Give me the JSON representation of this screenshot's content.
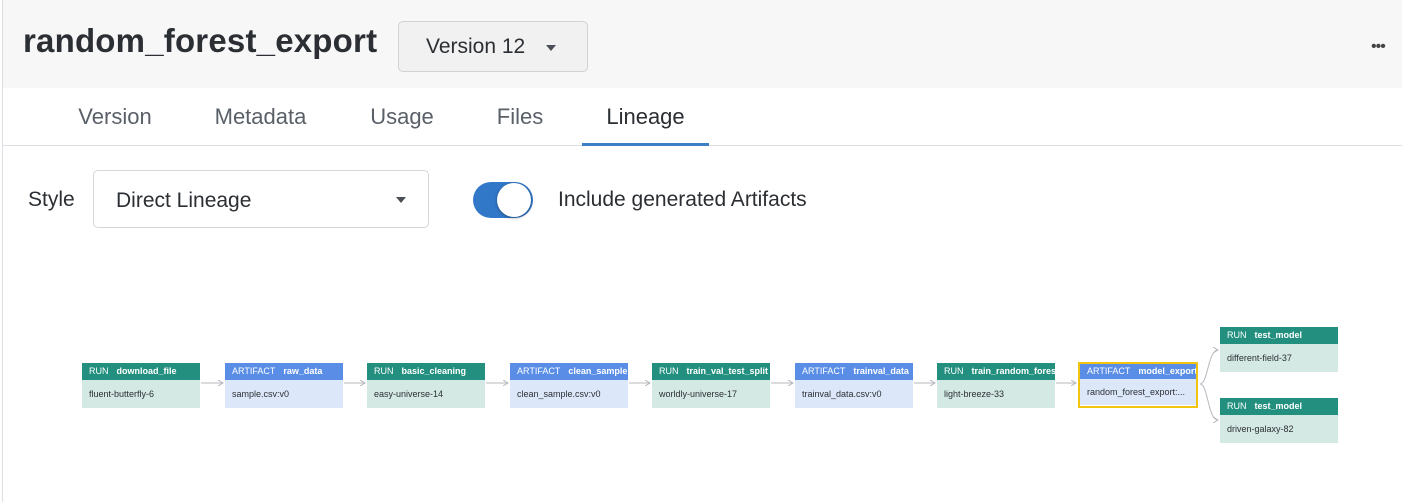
{
  "header": {
    "title": "random_forest_export",
    "version_select": "Version 12",
    "more_icon": "•••"
  },
  "tabs": [
    {
      "label": "Version",
      "active": false
    },
    {
      "label": "Metadata",
      "active": false
    },
    {
      "label": "Usage",
      "active": false
    },
    {
      "label": "Files",
      "active": false
    },
    {
      "label": "Lineage",
      "active": true
    }
  ],
  "controls": {
    "style_label": "Style",
    "style_value": "Direct Lineage",
    "toggle_label": "Include generated Artifacts",
    "toggle_on": true
  },
  "colors": {
    "run_header": "#23907f",
    "run_body": "#d4e8e4",
    "artifact_header": "#5a8ee6",
    "artifact_body": "#dce8f9",
    "selected_border": "#f1c40f",
    "tab_active": "#3d7fc4",
    "toggle_on": "#3278c8"
  },
  "lineage": {
    "nodes": [
      {
        "type": "RUN",
        "name": "download_file",
        "sub": "fluent-butterfly-6"
      },
      {
        "type": "ARTIFACT",
        "name": "raw_data",
        "sub": "sample.csv:v0"
      },
      {
        "type": "RUN",
        "name": "basic_cleaning",
        "sub": "easy-universe-14"
      },
      {
        "type": "ARTIFACT",
        "name": "clean_sample",
        "sub": "clean_sample.csv:v0"
      },
      {
        "type": "RUN",
        "name": "train_val_test_split",
        "sub": "worldly-universe-17"
      },
      {
        "type": "ARTIFACT",
        "name": "trainval_data",
        "sub": "trainval_data.csv:v0"
      },
      {
        "type": "RUN",
        "name": "train_random_forest",
        "sub": "light-breeze-33"
      },
      {
        "type": "ARTIFACT",
        "name": "model_export",
        "sub": "random_forest_export:...",
        "selected": true
      },
      {
        "type": "RUN",
        "name": "test_model",
        "sub": "different-field-37"
      },
      {
        "type": "RUN",
        "name": "test_model",
        "sub": "driven-galaxy-82"
      }
    ]
  }
}
